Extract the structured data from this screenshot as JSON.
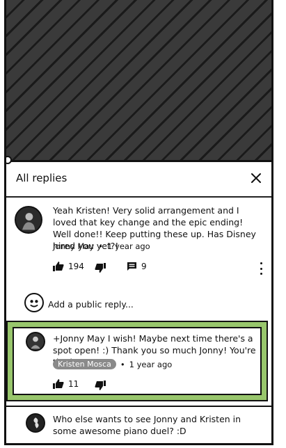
{
  "header": {
    "title": "All replies"
  },
  "parent_comment": {
    "text": "Yeah Kristen!  Very solid arrangement and I loved that key change and the epic ending!  Well done!! Keep putting these up.  Has Disney hired you yet?!",
    "author": "Jonny May",
    "separator": "•",
    "age": "1 year ago",
    "likes": "194",
    "replies": "9"
  },
  "reply_input": {
    "placeholder": "Add a public reply..."
  },
  "highlighted_reply": {
    "text": "+Jonny May I wish! Maybe next time there's a spot open! :) Thank you so much Jonny! You're the best!",
    "author": "Kristen Mosca",
    "separator": "•",
    "age": "1 year ago",
    "likes": "11",
    "highlight_color": "#98c66c"
  },
  "next_reply": {
    "text": "Who else wants to see Jonny and Kristen in some awesome piano duel? :D"
  },
  "icons": {
    "close": "close-icon",
    "like": "thumbs-up-icon",
    "dislike": "thumbs-down-icon",
    "reply": "comment-icon",
    "more": "more-vertical-icon"
  }
}
